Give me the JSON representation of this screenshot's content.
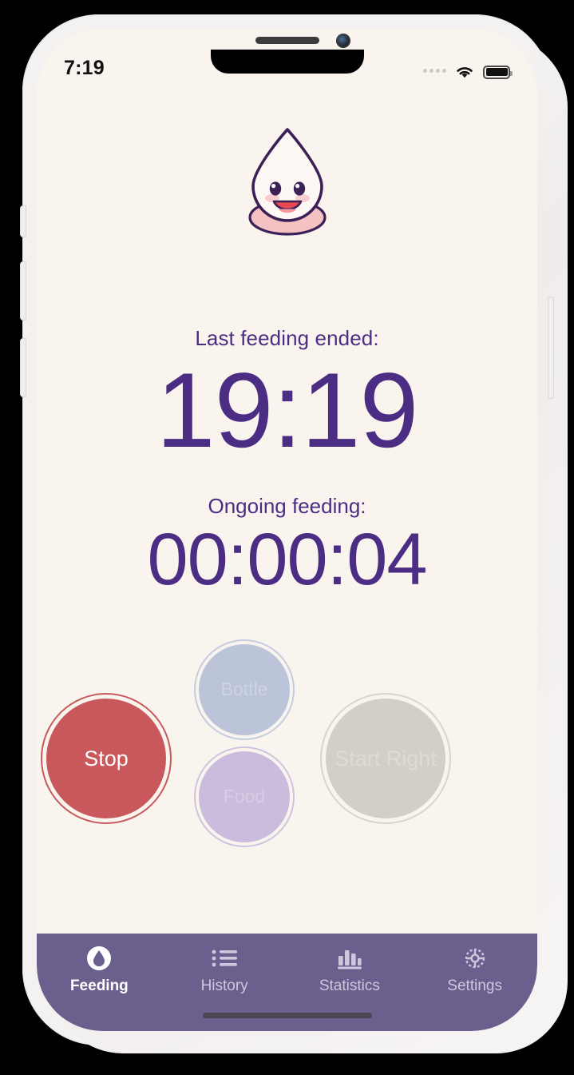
{
  "status_bar": {
    "time": "7:19",
    "signal_icon": "signal-dots-icon",
    "wifi_icon": "wifi-icon",
    "battery_icon": "battery-full-icon"
  },
  "app": {
    "mascot_icon": "milk-drop-mascot-icon",
    "last_feeding_label": "Last feeding ended:",
    "last_feeding_time": "19:19",
    "ongoing_label": "Ongoing feeding:",
    "ongoing_time": "00:00:04"
  },
  "actions": {
    "stop": {
      "label": "Stop",
      "color": "#c8585c",
      "enabled": true
    },
    "bottle": {
      "label": "Bottle",
      "color": "#bcc4da",
      "enabled": false
    },
    "food": {
      "label": "Food",
      "color": "#c9bcdc",
      "enabled": false
    },
    "start_right": {
      "label": "Start Right",
      "color": "#d2cfc9",
      "enabled": false
    }
  },
  "tabs": [
    {
      "label": "Feeding",
      "icon": "drop-icon",
      "active": true
    },
    {
      "label": "History",
      "icon": "list-icon",
      "active": false
    },
    {
      "label": "Statistics",
      "icon": "bar-chart-icon",
      "active": false
    },
    {
      "label": "Settings",
      "icon": "gear-icon",
      "active": false
    }
  ],
  "theme": {
    "screen_background": "#faf4ee",
    "accent_purple": "#4b2e83",
    "tabbar_purple": "#6b5f8e"
  }
}
